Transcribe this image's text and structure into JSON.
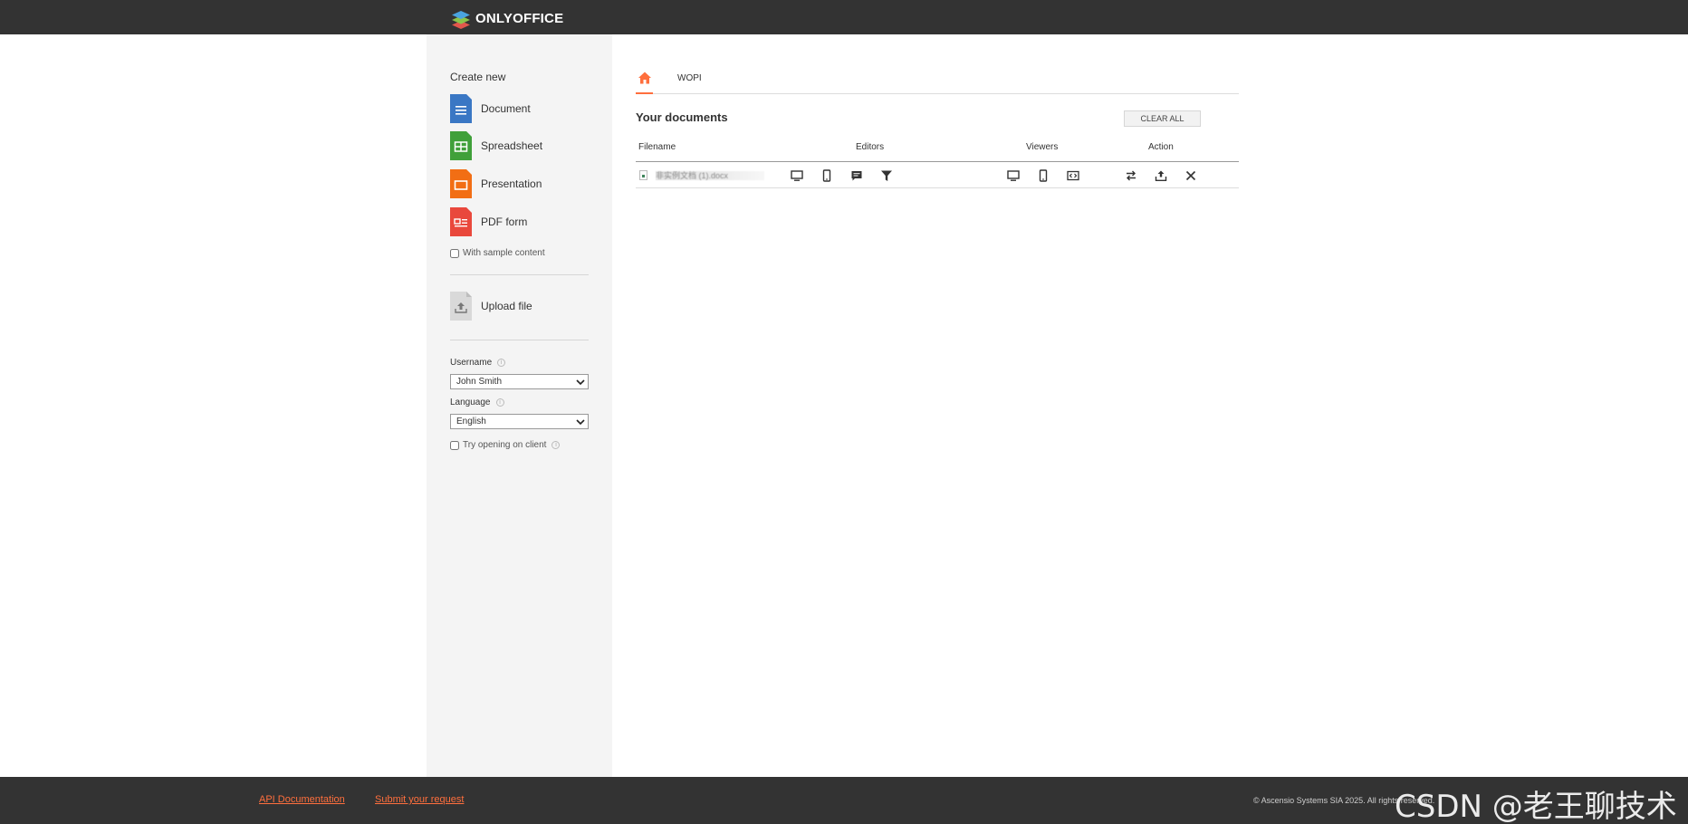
{
  "header": {
    "brand": "ONLYOFFICE"
  },
  "sidebar": {
    "create_title": "Create new",
    "create_items": [
      {
        "label": "Document",
        "color": "#3a77c4"
      },
      {
        "label": "Spreadsheet",
        "color": "#40a03a"
      },
      {
        "label": "Presentation",
        "color": "#f26e14"
      },
      {
        "label": "PDF form",
        "color": "#e9483c"
      }
    ],
    "sample_content_label": "With sample content",
    "upload_label": "Upload file",
    "username_label": "Username",
    "username_value": "John Smith",
    "language_label": "Language",
    "language_value": "English",
    "client_open_label": "Try opening on client"
  },
  "main": {
    "tabs": {
      "home_icon": "home-icon",
      "wopi": "WOPI"
    },
    "docs_title": "Your documents",
    "clear_all": "CLEAR ALL",
    "columns": {
      "filename": "Filename",
      "editors": "Editors",
      "viewers": "Viewers",
      "action": "Action"
    },
    "rows": [
      {
        "filename": "非实例文档 (1).docx",
        "editor_icons": [
          "desktop-icon",
          "mobile-icon",
          "comment-icon",
          "filter-icon"
        ],
        "viewer_icons": [
          "desktop-icon",
          "mobile-icon",
          "embedded-icon"
        ],
        "action_icons": [
          "convert-icon",
          "download-icon",
          "delete-icon"
        ]
      }
    ]
  },
  "footer": {
    "api_docs": "API Documentation",
    "submit_request": "Submit your request",
    "copyright": "© Ascensio Systems SIA 2025. All rights reserved.",
    "watermark": "CSDN @老王聊技术"
  },
  "colors": {
    "accent": "#ff6f3d",
    "topbar": "#333333",
    "sidebar_bg": "#f4f4f4"
  }
}
